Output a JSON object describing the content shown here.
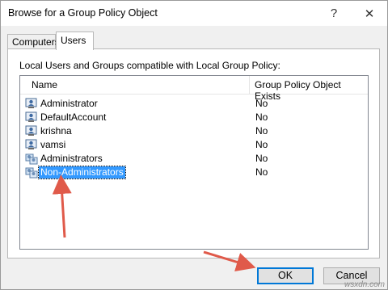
{
  "window": {
    "title": "Browse for a Group Policy Object",
    "help_glyph": "?",
    "close_glyph": "✕"
  },
  "tabs": [
    {
      "label": "Computers",
      "active": false
    },
    {
      "label": "Users",
      "active": true
    }
  ],
  "panel": {
    "description": "Local Users and Groups compatible with Local Group Policy:"
  },
  "list": {
    "columns": [
      "Name",
      "Group Policy Object Exists"
    ],
    "rows": [
      {
        "name": "Administrator",
        "exists": "No",
        "icon": "user-icon",
        "selected": false
      },
      {
        "name": "DefaultAccount",
        "exists": "No",
        "icon": "user-icon",
        "selected": false
      },
      {
        "name": "krishna",
        "exists": "No",
        "icon": "user-icon",
        "selected": false
      },
      {
        "name": "vamsi",
        "exists": "No",
        "icon": "user-icon",
        "selected": false
      },
      {
        "name": "Administrators",
        "exists": "No",
        "icon": "group-icon",
        "selected": false
      },
      {
        "name": "Non-Administrators",
        "exists": "No",
        "icon": "group-icon",
        "selected": true
      }
    ]
  },
  "buttons": {
    "ok": "OK",
    "cancel": "Cancel"
  },
  "annotations": {
    "arrow_color": "#e05a4a"
  },
  "watermark": "wsxdn.com",
  "colors": {
    "selection": "#3399ff",
    "default_button_border": "#0078d7"
  }
}
